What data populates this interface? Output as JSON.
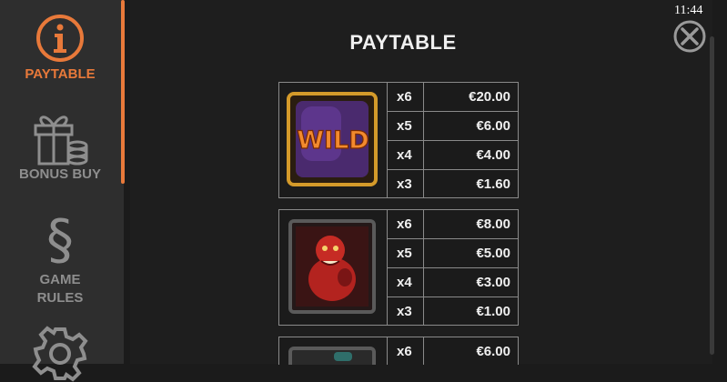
{
  "sidebar": {
    "items": [
      {
        "label": "PAYTABLE",
        "icon": "info-icon",
        "active": true
      },
      {
        "label": "BONUS BUY",
        "icon": "gift-coins-icon",
        "active": false
      },
      {
        "label": "GAME RULES",
        "icon": "section-sign-icon",
        "active": false
      },
      {
        "label": "",
        "icon": "gear-icon",
        "active": false
      }
    ]
  },
  "header": {
    "title": "PAYTABLE",
    "clock": "11:44",
    "close_icon": "close-icon"
  },
  "paytable": [
    {
      "symbol": "wild-symbol",
      "symbol_text": "WILD",
      "rows": [
        {
          "count": "x6",
          "amount": "€20.00"
        },
        {
          "count": "x5",
          "amount": "€6.00"
        },
        {
          "count": "x4",
          "amount": "€4.00"
        },
        {
          "count": "x3",
          "amount": "€1.60"
        }
      ]
    },
    {
      "symbol": "red-monster-symbol",
      "rows": [
        {
          "count": "x6",
          "amount": "€8.00"
        },
        {
          "count": "x5",
          "amount": "€5.00"
        },
        {
          "count": "x4",
          "amount": "€3.00"
        },
        {
          "count": "x3",
          "amount": "€1.00"
        }
      ]
    },
    {
      "symbol": "partial-symbol",
      "rows": [
        {
          "count": "x6",
          "amount": "€6.00"
        }
      ]
    }
  ],
  "colors": {
    "accent": "#e8793a",
    "sidebar_bg": "#2e2e2e",
    "main_bg": "#1e1e1e",
    "inactive_text": "#8e8e8e"
  }
}
